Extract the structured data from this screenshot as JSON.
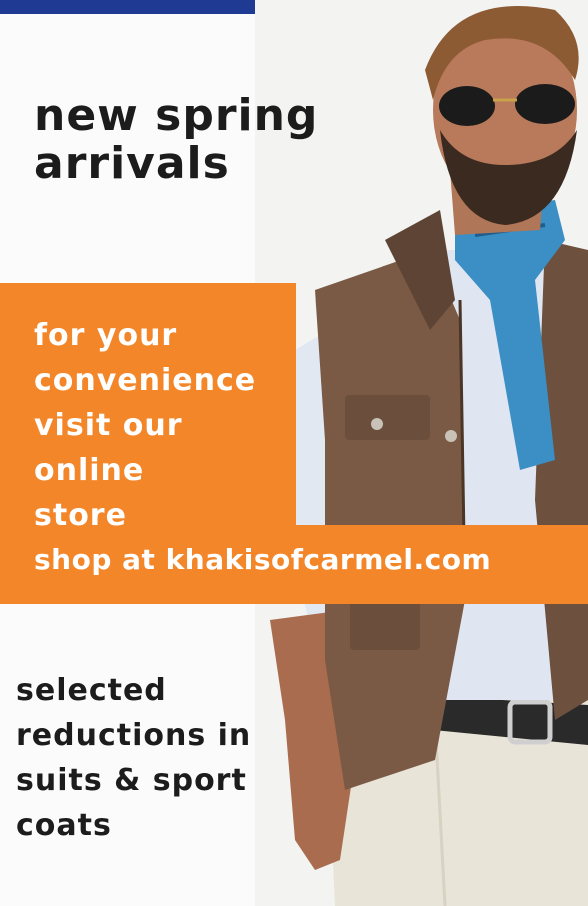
{
  "headline": {
    "line1": "new spring",
    "line2": "arrivals"
  },
  "convenience": {
    "line1": "for your",
    "line2": "convenience",
    "line3": "visit our",
    "line4": "online",
    "line5": "store"
  },
  "shop": {
    "text": "shop at khakisofcarmel.com"
  },
  "reductions": {
    "line1": "selected",
    "line2": "reductions in",
    "line3": "suits & sport",
    "line4": "coats"
  },
  "colors": {
    "accent": "#f4862a",
    "top_bar": "#1f3a93",
    "text_dark": "#1c1c1c",
    "text_light": "#ffffff"
  }
}
